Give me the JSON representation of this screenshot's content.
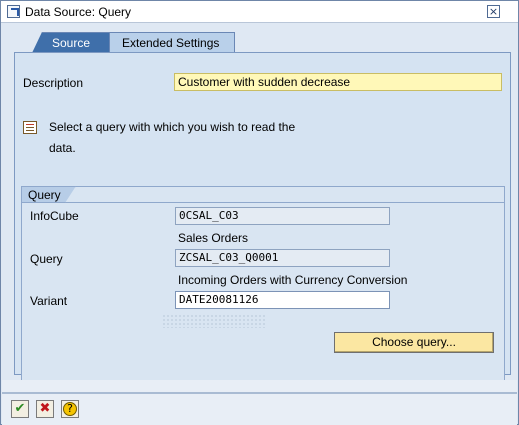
{
  "window": {
    "title": "Data Source: Query",
    "close_label": "×"
  },
  "tabs": [
    {
      "label": "Source"
    },
    {
      "label": "Extended Settings"
    }
  ],
  "description": {
    "label": "Description",
    "value": "Customer with sudden decrease"
  },
  "info": {
    "line1": "Select a query with which you wish to read the",
    "line2": "data."
  },
  "query_group": {
    "title": "Query",
    "infocube_label": "InfoCube",
    "infocube_value": "0CSAL_C03",
    "infocube_desc": "Sales Orders",
    "query_label": "Query",
    "query_value": "ZCSAL_C03_Q0001",
    "query_desc": "Incoming Orders with Currency Conversion",
    "variant_label": "Variant",
    "variant_value": "DATE20081126",
    "choose_button": "Choose query..."
  },
  "footer": {
    "ok_icon": "✔",
    "cancel_icon": "✖",
    "help_icon": "?"
  }
}
